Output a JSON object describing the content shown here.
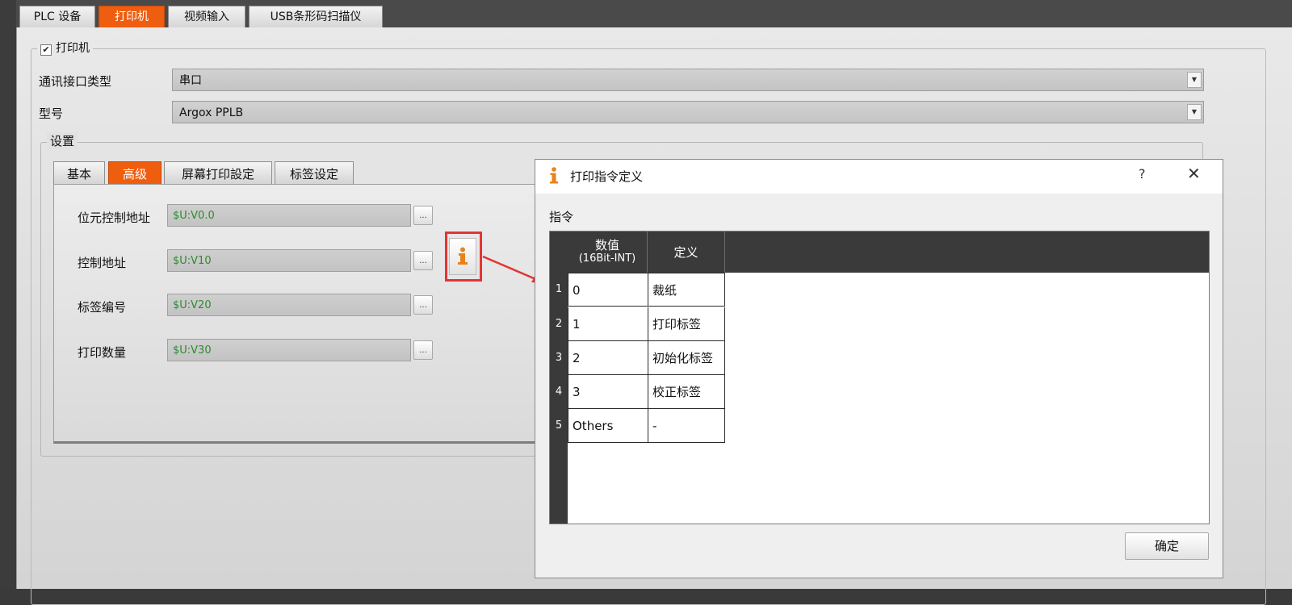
{
  "top_tabs": [
    {
      "label": "PLC 设备",
      "active": false
    },
    {
      "label": "打印机",
      "active": true
    },
    {
      "label": "视频输入",
      "active": false
    },
    {
      "label": "USB条形码扫描仪",
      "active": false
    }
  ],
  "printer": {
    "enabled": true,
    "check_mark": "✔",
    "group_label": "打印机",
    "comm_interface_label": "通讯接口类型",
    "comm_interface_value": "串口",
    "model_label": "型号",
    "model_value": "Argox PPLB"
  },
  "settings": {
    "group_label": "设置",
    "tabs": [
      {
        "label": "基本",
        "active": false
      },
      {
        "label": "高级",
        "active": true
      },
      {
        "label": "屏幕打印設定",
        "active": false
      },
      {
        "label": "标签设定",
        "active": false
      }
    ],
    "fields": [
      {
        "label": "位元控制地址",
        "value": "$U:V0.0"
      },
      {
        "label": "控制地址",
        "value": "$U:V10"
      },
      {
        "label": "标签编号",
        "value": "$U:V20"
      },
      {
        "label": "打印数量",
        "value": "$U:V30"
      }
    ],
    "browse_label": "..."
  },
  "dialog": {
    "title": "打印指令定义",
    "help": "?",
    "close": "✕",
    "section_label": "指令",
    "columns": {
      "value_line1": "数值",
      "value_line2": "(16Bit-INT)",
      "definition": "定义"
    },
    "rows": [
      {
        "num": "1",
        "value": "0",
        "definition": "裁纸"
      },
      {
        "num": "2",
        "value": "1",
        "definition": "打印标签"
      },
      {
        "num": "3",
        "value": "2",
        "definition": "初始化标签"
      },
      {
        "num": "4",
        "value": "3",
        "definition": "校正标签"
      },
      {
        "num": "5",
        "value": "Others",
        "definition": "-"
      }
    ],
    "ok_label": "确定"
  },
  "colors": {
    "accent_tab": "#ef5d0f",
    "highlight": "#e43434",
    "field_text": "#2e8a2e",
    "info_icon": "#e8821a"
  }
}
